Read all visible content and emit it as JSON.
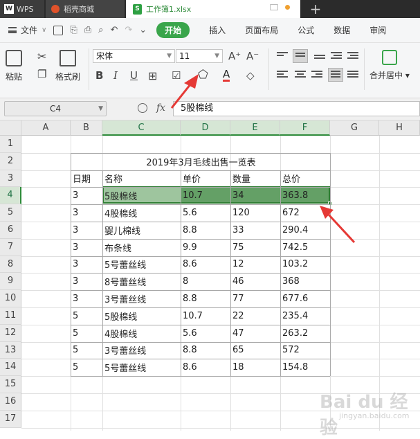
{
  "tabs": {
    "wps": "WPS",
    "store": "稻壳商城",
    "file": "工作簿1.xlsx"
  },
  "menu": {
    "file": "文件",
    "start": "开始",
    "items": [
      "插入",
      "页面布局",
      "公式",
      "数据",
      "审阅"
    ]
  },
  "ribbon": {
    "paste": "粘贴",
    "format_painter": "格式刷",
    "font": "宋体",
    "size": "11",
    "bold": "B",
    "italic": "I",
    "underline": "U",
    "font_color_letter": "A",
    "merge_center": "合并居中",
    "grow": "A⁺",
    "shrink": "A⁻"
  },
  "formula_bar": {
    "cell_ref": "C4",
    "fx": "fx",
    "value": "5股棉线"
  },
  "columns": [
    "A",
    "B",
    "C",
    "D",
    "E",
    "F",
    "G",
    "H"
  ],
  "rows": [
    "1",
    "2",
    "3",
    "4",
    "5",
    "6",
    "7",
    "8",
    "9",
    "10",
    "11",
    "12",
    "13",
    "14",
    "15",
    "16",
    "17"
  ],
  "sheet": {
    "title": "2019年3月毛线出售一览表",
    "headers": [
      "日期",
      "名称",
      "单价",
      "数量",
      "总价"
    ],
    "data": [
      [
        "3",
        "5股棉线",
        "10.7",
        "34",
        "363.8"
      ],
      [
        "3",
        "4股棉线",
        "5.6",
        "120",
        "672"
      ],
      [
        "3",
        "婴儿棉线",
        "8.8",
        "33",
        "290.4"
      ],
      [
        "3",
        "布条线",
        "9.9",
        "75",
        "742.5"
      ],
      [
        "3",
        "5号蕾丝线",
        "8.6",
        "12",
        "103.2"
      ],
      [
        "3",
        "8号蕾丝线",
        "8",
        "46",
        "368"
      ],
      [
        "3",
        "3号蕾丝线",
        "8.8",
        "77",
        "677.6"
      ],
      [
        "5",
        "5股棉线",
        "10.7",
        "22",
        "235.4"
      ],
      [
        "5",
        "4股棉线",
        "5.6",
        "47",
        "263.2"
      ],
      [
        "5",
        "3号蕾丝线",
        "8.8",
        "65",
        "572"
      ],
      [
        "5",
        "5号蕾丝线",
        "8.6",
        "18",
        "154.8"
      ]
    ]
  },
  "watermark": {
    "main": "Bai du 经验",
    "sub": "jingyan.baidu.com"
  },
  "colors": {
    "accent": "#3aa54b",
    "selection": "#64a066",
    "arrow": "#e53935"
  }
}
